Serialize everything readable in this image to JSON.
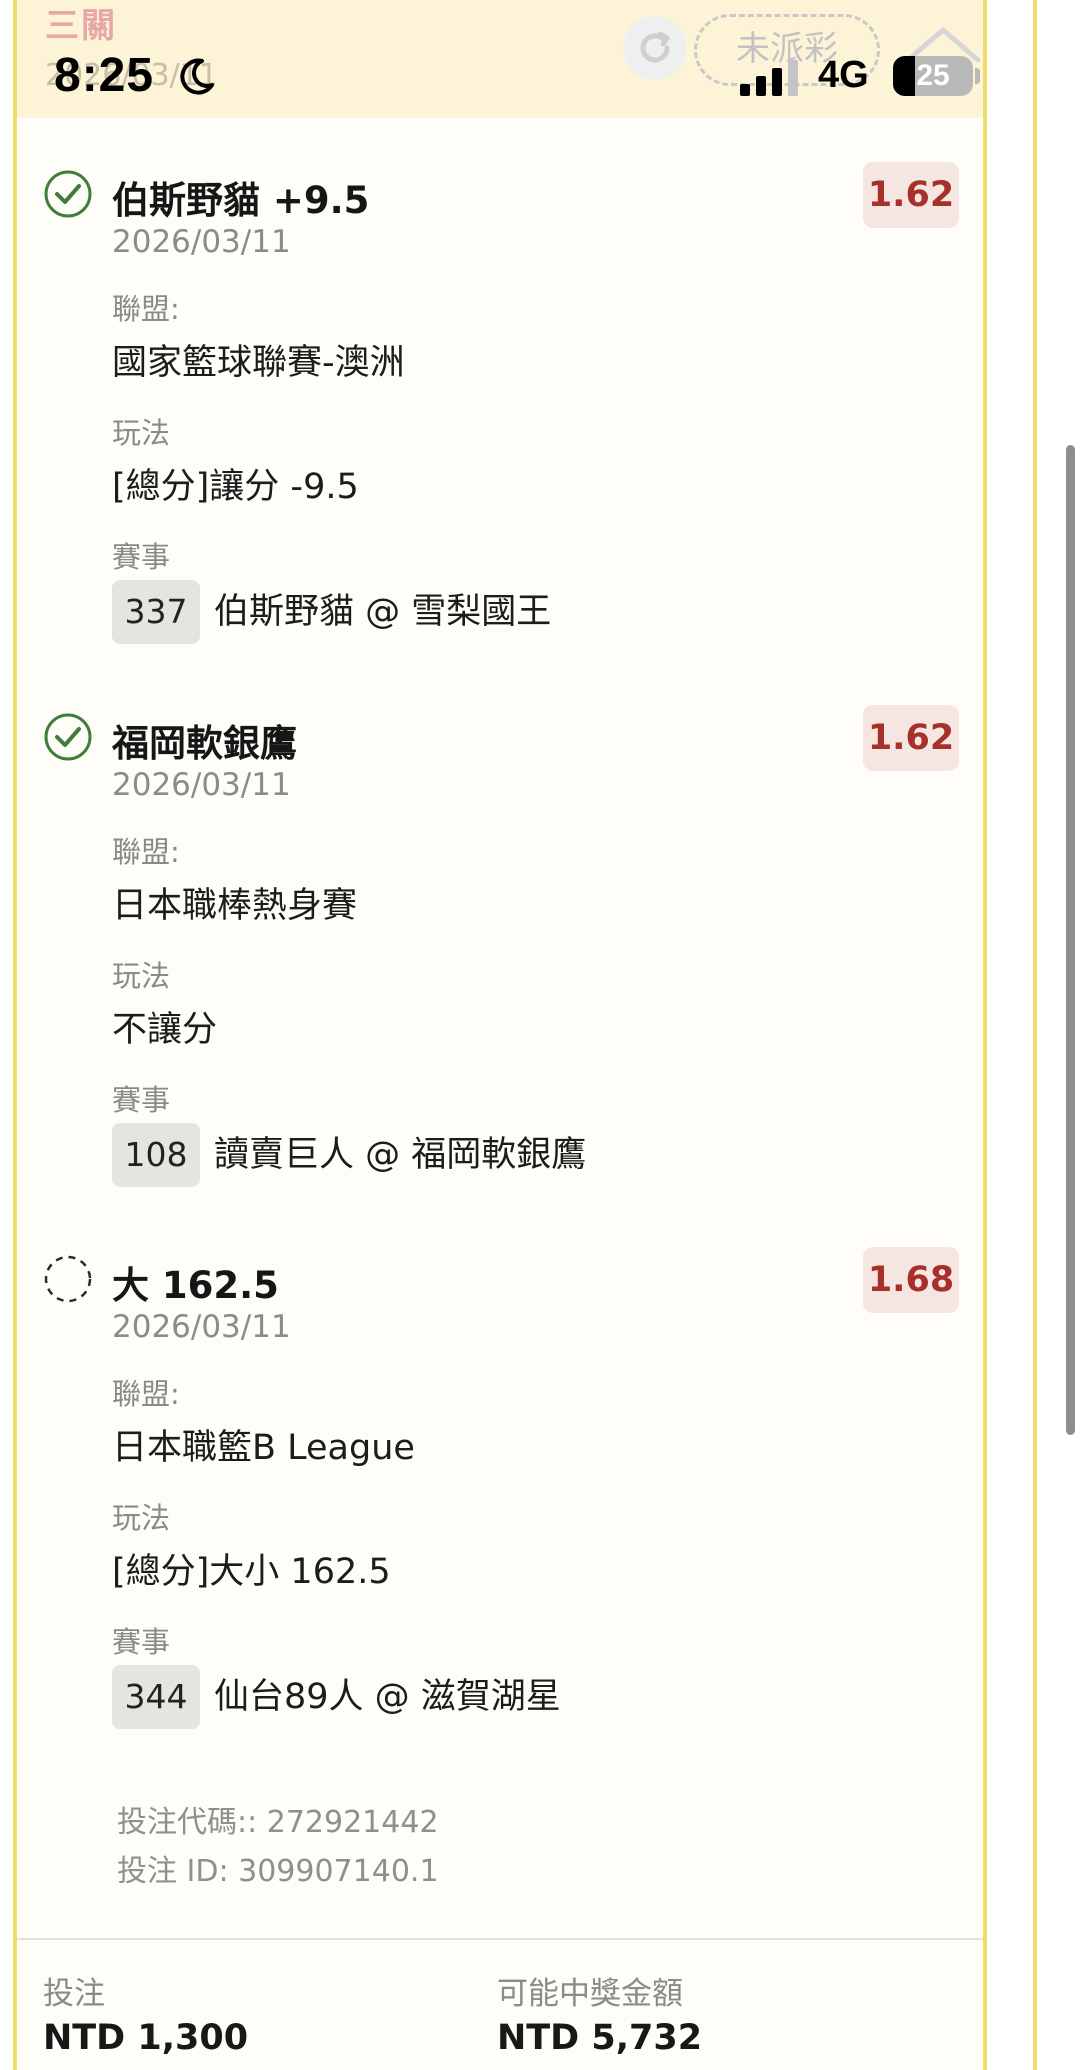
{
  "status_bar": {
    "time": "8:25",
    "network": "4G",
    "battery": "25"
  },
  "ticket": {
    "title": "三關",
    "date": "2026/03/11",
    "status": "未派彩"
  },
  "labels": {
    "league": "聯盟:",
    "bet_type": "玩法",
    "event": "賽事"
  },
  "selections": [
    {
      "name": "伯斯野貓 +9.5",
      "odds": "1.62",
      "date": "2026/03/11",
      "league": "國家籃球聯賽-澳洲",
      "bet_type": "[總分]讓分 -9.5",
      "event_number": "337",
      "event_teams": "伯斯野貓 @ 雪梨國王",
      "state": "won",
      "icon": "check-circle-icon"
    },
    {
      "name": "福岡軟銀鷹",
      "odds": "1.62",
      "date": "2026/03/11",
      "league": "日本職棒熱身賽",
      "bet_type": "不讓分",
      "event_number": "108",
      "event_teams": "讀賣巨人 @ 福岡軟銀鷹",
      "state": "won",
      "icon": "check-circle-icon"
    },
    {
      "name": "大 162.5",
      "odds": "1.68",
      "date": "2026/03/11",
      "league": "日本職籃B League",
      "bet_type": "[總分]大小 162.5",
      "event_number": "344",
      "event_teams": "仙台89人 @ 滋賀湖星",
      "state": "pending",
      "icon": "dashed-circle-icon"
    }
  ],
  "meta": {
    "bet_code": "投注代碼:: 272921442",
    "bet_id": "投注 ID: 309907140.1"
  },
  "summary": {
    "stake_label": "投注",
    "stake_value": "NTD 1,300",
    "payout_label": "可能中獎金額",
    "payout_value": "NTD 5,732"
  },
  "colors": {
    "card_border": "#efdc6a",
    "card_background": "#fffdf7",
    "header_background": "#fdf3d6",
    "odds_text": "#a5312a",
    "odds_background": "#f5e6e1",
    "check_green": "#3f7d3a"
  }
}
